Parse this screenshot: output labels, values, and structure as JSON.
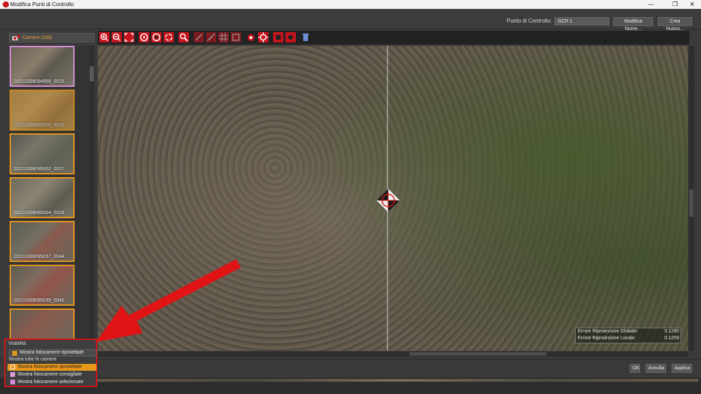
{
  "window": {
    "title": "Modifica Punti di Controllo",
    "controls": {
      "minimize": "—",
      "maximize": "❐",
      "close": "✕"
    }
  },
  "header": {
    "gcp_label": "Punto di Controllo:",
    "gcp_value": "GCP 1",
    "rename_button": "Modifica Nome...",
    "create_button": "Crea Nuovo..."
  },
  "camera_panel": {
    "label": "Camere (339)",
    "thumbnails": [
      {
        "caption": "20210308094958_0025",
        "selected": true
      },
      {
        "caption": "20210308095000_0026",
        "selected": false
      },
      {
        "caption": "20210308095002_0027",
        "selected": false
      },
      {
        "caption": "20210308095004_0028",
        "selected": false
      },
      {
        "caption": "20210308095037_0044",
        "selected": false
      },
      {
        "caption": "20210308095039_0045",
        "selected": false
      },
      {
        "caption": "",
        "selected": false
      }
    ]
  },
  "toolbar": {
    "tools": [
      "zoom-in-icon",
      "zoom-out-icon",
      "fit-view-icon",
      "target-icon",
      "target-alt-icon",
      "rotate-icon",
      "magnifier-icon",
      "draw-line-icon",
      "measure-icon",
      "grid-icon",
      "area-icon",
      "marker-icon",
      "center-target-icon",
      "record-square-icon",
      "record-circle-icon",
      "trash-icon"
    ]
  },
  "errors": {
    "global_label": "Errore Riproiezione Globale:",
    "global_value": "0.1260",
    "local_label": "Errore Riproiezione Locale:",
    "local_value": "0.1259"
  },
  "actions": {
    "ok": "OK",
    "cancel": "Annulla",
    "apply": "Applica"
  },
  "visibility": {
    "title": "Visibilità:",
    "dropdown_value": "Mostra fotocamere riproiettate",
    "show_all": "Mostra tutte le camere",
    "options": [
      {
        "label": "Mostra fotocamere riproiettate",
        "color": "#e8981c",
        "active": true
      },
      {
        "label": "Mostra fotocamere consigliate",
        "color": "#e09ad8",
        "active": false
      },
      {
        "label": "Mostra fotocamere selezionate",
        "color": "#d68ed8",
        "active": false
      }
    ]
  },
  "colors": {
    "accent": "#e8981c",
    "selected_border": "#d68ed8",
    "annotation": "#d21414"
  }
}
